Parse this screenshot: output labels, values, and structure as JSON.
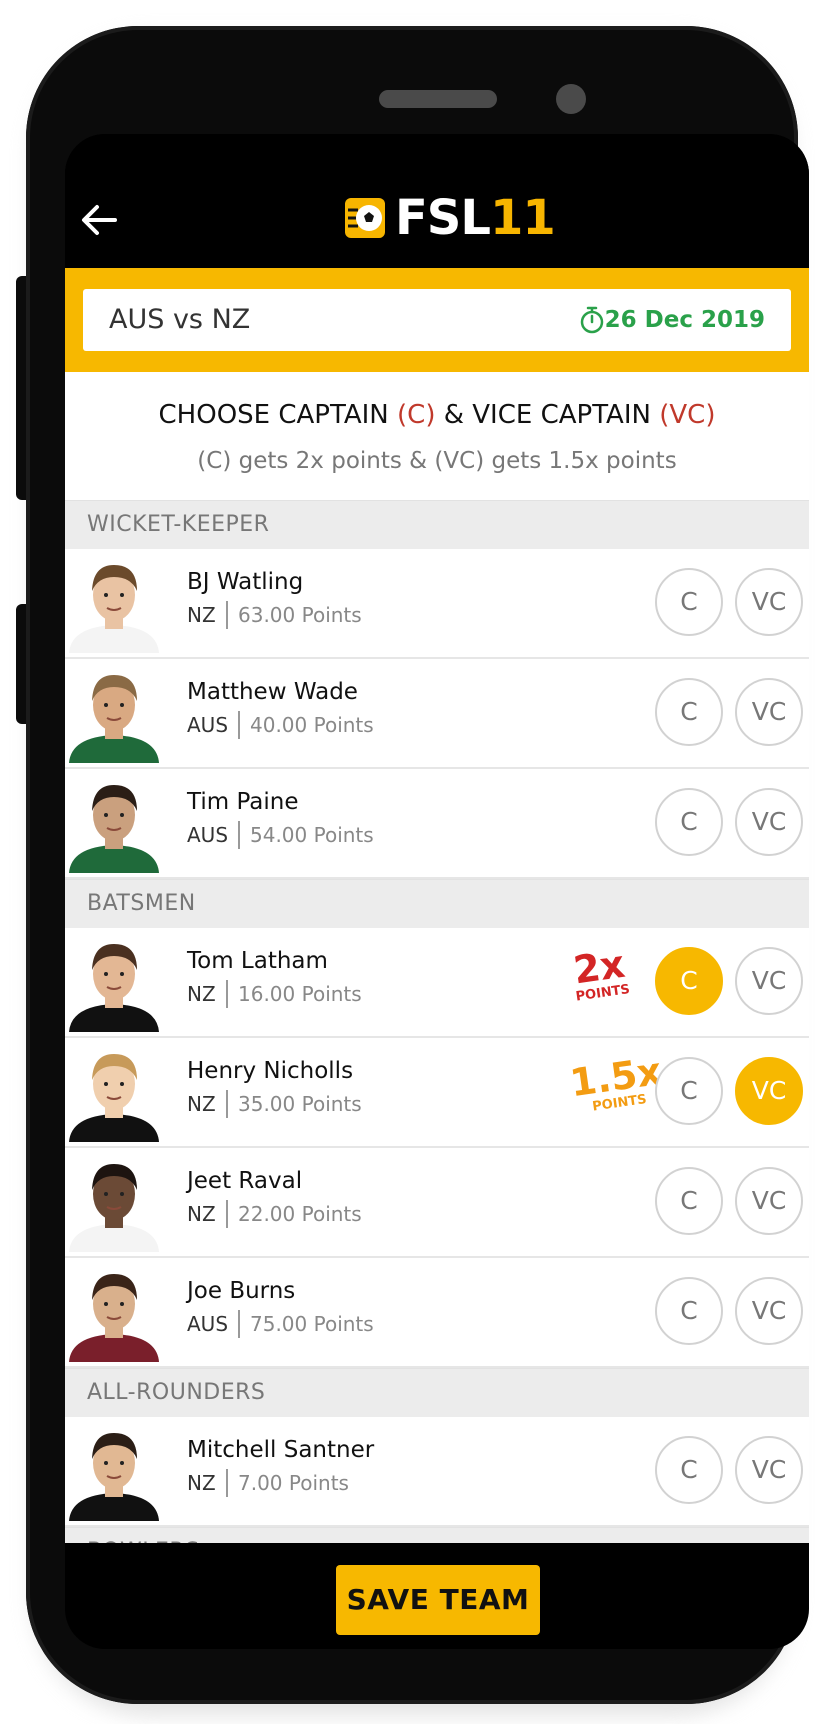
{
  "app": {
    "logo_prefix": "FSL",
    "logo_number": "11"
  },
  "match": {
    "title": "AUS vs NZ",
    "date": "26 Dec 2019"
  },
  "heading": {
    "part1": "CHOOSE CAPTAIN ",
    "c_tag": "(C)",
    "part2": " & VICE CAPTAIN ",
    "vc_tag": "(VC)",
    "subtitle": "(C) gets 2x points & (VC) gets 1.5x points"
  },
  "buttons": {
    "c": "C",
    "vc": "VC",
    "save": "SAVE TEAM"
  },
  "badges": {
    "captain_big": "2x",
    "captain_small": "POINTS",
    "vice_big": "1.5x",
    "vice_small": "POINTS"
  },
  "colors": {
    "accent": "#f7b800",
    "date_green": "#2aa14a",
    "captain_red": "#c0392b"
  },
  "sections": [
    {
      "title": "WICKET-KEEPER",
      "players": [
        {
          "name": "BJ Watling",
          "team": "NZ",
          "points": "63.00 Points",
          "captain": false,
          "vice": false
        },
        {
          "name": "Matthew Wade",
          "team": "AUS",
          "points": "40.00 Points",
          "captain": false,
          "vice": false
        },
        {
          "name": "Tim Paine",
          "team": "AUS",
          "points": "54.00 Points",
          "captain": false,
          "vice": false
        }
      ]
    },
    {
      "title": "BATSMEN",
      "players": [
        {
          "name": "Tom Latham",
          "team": "NZ",
          "points": "16.00 Points",
          "captain": true,
          "vice": false
        },
        {
          "name": "Henry Nicholls",
          "team": "NZ",
          "points": "35.00 Points",
          "captain": false,
          "vice": true
        },
        {
          "name": "Jeet Raval",
          "team": "NZ",
          "points": "22.00 Points",
          "captain": false,
          "vice": false
        },
        {
          "name": "Joe Burns",
          "team": "AUS",
          "points": "75.00 Points",
          "captain": false,
          "vice": false
        }
      ]
    },
    {
      "title": "ALL-ROUNDERS",
      "players": [
        {
          "name": "Mitchell Santner",
          "team": "NZ",
          "points": "7.00 Points",
          "captain": false,
          "vice": false
        }
      ]
    },
    {
      "title": "BOWLERS",
      "players": []
    }
  ]
}
